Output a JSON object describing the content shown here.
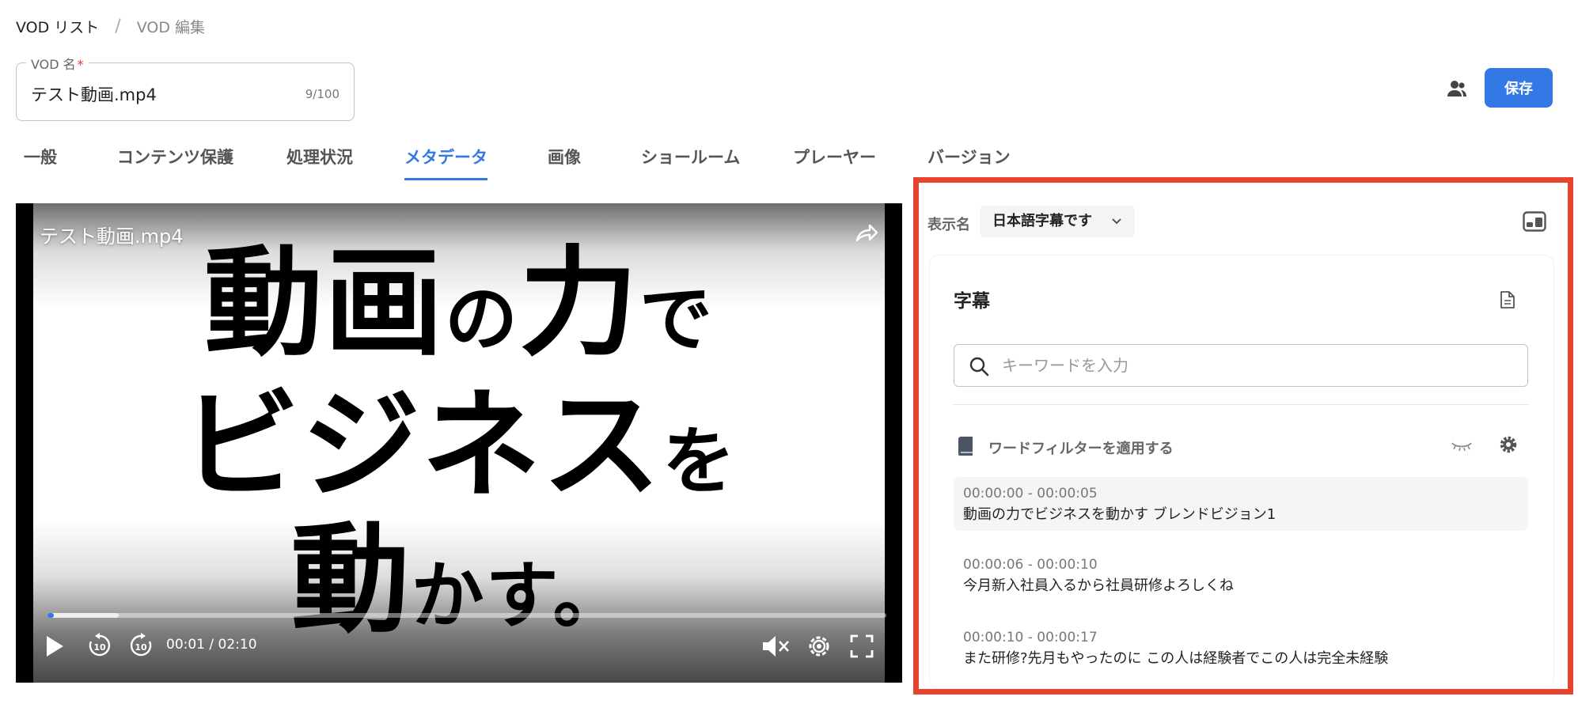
{
  "breadcrumb": {
    "root": "VOD リスト",
    "separator": "/",
    "current": "VOD 編集"
  },
  "vod_name": {
    "label": "VOD 名",
    "required_mark": "*",
    "value": "テスト動画.mp4",
    "char_count": "9/100"
  },
  "header": {
    "save_label": "保存",
    "icons": [
      "users-icon"
    ]
  },
  "tabs": [
    {
      "label": "一般",
      "active": false
    },
    {
      "label": "コンテンツ保護",
      "active": false
    },
    {
      "label": "処理状況",
      "active": false
    },
    {
      "label": "メタデータ",
      "active": true
    },
    {
      "label": "画像",
      "active": false
    },
    {
      "label": "ショールーム",
      "active": false
    },
    {
      "label": "プレーヤー",
      "active": false
    },
    {
      "label": "バージョン",
      "active": false
    }
  ],
  "player": {
    "title": "テスト動画.mp4",
    "frame_text": {
      "line1": [
        "動画",
        "の",
        "力",
        "で"
      ],
      "line2": [
        "ビジネス",
        "を"
      ],
      "line3": [
        "動",
        "かす。"
      ]
    },
    "current_time": "00:01",
    "duration": "02:10",
    "progress_played": 0.008,
    "progress_buffered": 0.085,
    "icons": [
      "share-icon",
      "play-icon",
      "rewind-10-icon",
      "forward-10-icon",
      "mute-icon",
      "settings-icon",
      "fullscreen-icon"
    ]
  },
  "subtitle_panel": {
    "display_label": "表示名",
    "display_value": "日本語字幕です",
    "title": "字幕",
    "search_placeholder": "キーワードを入力",
    "word_filter_label": "ワードフィルターを適用する",
    "cues": [
      {
        "time": "00:00:00 - 00:00:05",
        "text": "動画の力でビジネスを動かす ブレンドビジョン1",
        "active": true
      },
      {
        "time": "00:00:06 - 00:00:10",
        "text": "今月新入社員入るから社員研修よろしくね",
        "active": false
      },
      {
        "time": "00:00:10 - 00:00:17",
        "text": "また研修?先月もやったのに この人は経験者でこの人は完全未経験",
        "active": false
      }
    ]
  },
  "colors": {
    "accent": "#3478e5",
    "highlight_border": "#e8432e",
    "active_cue_bg": "#f4f5f7"
  }
}
